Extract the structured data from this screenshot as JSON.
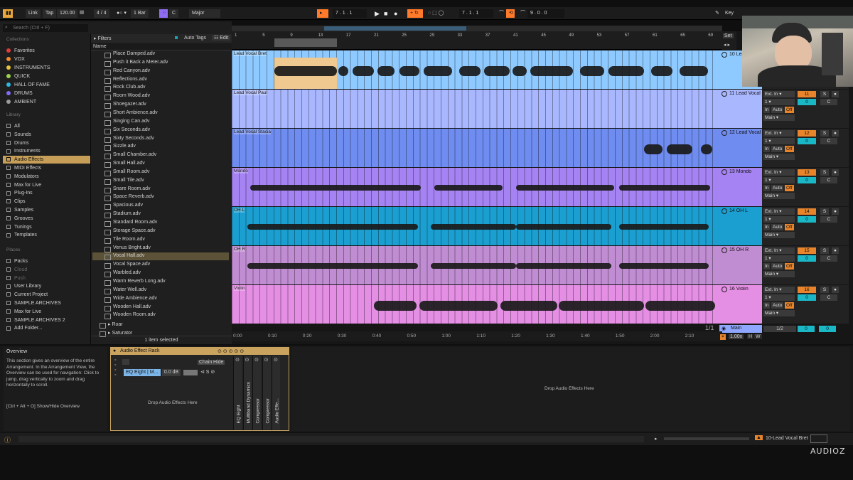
{
  "transport": {
    "link": "Link",
    "tap": "Tap",
    "tempo": "120.00",
    "signature": "4 / 4",
    "quantize": "1 Bar",
    "key": "C",
    "scale": "Major",
    "position": "7 . 1 . 1",
    "loop_start": "7 . 1 . 1",
    "loop_length": "9 . 0 . 0",
    "key_label": "Key"
  },
  "browser": {
    "search_placeholder": "Search (Ctrl + F)",
    "collections_label": "Collections",
    "collections": [
      {
        "label": "Favorites",
        "color": "#e23b3b"
      },
      {
        "label": "VOX",
        "color": "#f08a2c"
      },
      {
        "label": "INSTRUMENTS",
        "color": "#e8c43a"
      },
      {
        "label": "QUICK",
        "color": "#9ad44a"
      },
      {
        "label": "HALL OF FAME",
        "color": "#2fb8e0"
      },
      {
        "label": "DRUMS",
        "color": "#7e6cf2"
      },
      {
        "label": "AMBIENT",
        "color": "#9a9a9a"
      }
    ],
    "library_label": "Library",
    "library": [
      "All",
      "Sounds",
      "Drums",
      "Instruments",
      "Audio Effects",
      "MIDI Effects",
      "Modulators",
      "Max for Live",
      "Plug-Ins",
      "Clips",
      "Samples",
      "Grooves",
      "Tunings",
      "Templates"
    ],
    "places_label": "Places",
    "places": [
      "Packs",
      "Cloud",
      "Push",
      "User Library",
      "Current Project",
      "SAMPLE ARCHIVES",
      "Max for Live",
      "SAMPLE ARCHIVES 2",
      "Add Folder..."
    ],
    "filters_label": "Filters",
    "auto_tags_label": "Auto Tags",
    "edit_label": "Edit",
    "name_header": "Name",
    "files": [
      "Place Damped.adv",
      "Push it Back a Meter.adv",
      "Red Canyon.adv",
      "Reflections.adv",
      "Rock Club.adv",
      "Room Wood.adv",
      "Shoegazer.adv",
      "Short Ambience.adv",
      "Singing Can.adv",
      "Six Seconds.adv",
      "Sixty Seconds.adv",
      "Sizzle.adv",
      "Small Chamber.adv",
      "Small Hall.adv",
      "Small Room.adv",
      "Small Tile.adv",
      "Snare Room.adv",
      "Space Reverb.adv",
      "Spacious.adv",
      "Stadium.adv",
      "Standard Room.adv",
      "Storage Space.adv",
      "Tile Room.adv",
      "Venus Bright.adv",
      "Vocal Hall.adv",
      "Vocal Space.adv",
      "Warbled.adv",
      "Warm Reverb Long.adv",
      "Water Well.adv",
      "Wide Ambience.adv",
      "Wooden Hall.adv",
      "Wooden Room.adv"
    ],
    "folders": [
      "Roar",
      "Saturator"
    ],
    "status": "1 item selected"
  },
  "ruler": {
    "marks": [
      "1",
      "5",
      "9",
      "13",
      "17",
      "21",
      "25",
      "29",
      "33",
      "37",
      "41",
      "45",
      "49",
      "53",
      "57",
      "61",
      "65",
      "69"
    ],
    "set_label": "Set"
  },
  "tracks": [
    {
      "clip": "Lead Vocal Bret",
      "header": "10 Lead Vocal Bret",
      "color": "#8ec9ff",
      "head_color": "#8ec9ff"
    },
    {
      "clip": "Lead Vocal Paul",
      "header": "11 Lead Vocal Paul",
      "color": "#a9b7ff",
      "head_color": "#a9b7ff",
      "input": "Ext. In",
      "ch": "1",
      "num": "11"
    },
    {
      "clip": "Lead Vocal Stacia",
      "header": "12 Lead Vocal Stacia",
      "color": "#6f8cf0",
      "head_color": "#6f8cf0",
      "input": "Ext. In",
      "ch": "1",
      "num": "12"
    },
    {
      "clip": "Mondo",
      "header": "13 Mondo",
      "color": "#a683f3",
      "head_color": "#a683f3",
      "input": "Ext. In",
      "ch": "1",
      "num": "13"
    },
    {
      "clip": "OH L",
      "header": "14 OH L",
      "color": "#1b9fd0",
      "head_color": "#1b9fd0",
      "input": "Ext. In",
      "ch": "1",
      "num": "14"
    },
    {
      "clip": "OH R",
      "header": "15 OH R",
      "color": "#c08cd2",
      "head_color": "#c08cd2",
      "input": "Ext. In",
      "ch": "1",
      "num": "15"
    },
    {
      "clip": "Violin",
      "header": "16 Violin",
      "color": "#e48ee4",
      "head_color": "#e48ee4",
      "input": "Ext. In",
      "ch": "1",
      "num": "16"
    }
  ],
  "mixer_labels": {
    "in": "In",
    "auto": "Auto",
    "off": "Off",
    "main": "Main",
    "s": "S",
    "c": "C",
    "zero": "0"
  },
  "main_track": {
    "label": "Main",
    "fraction": "1/2",
    "page": "1/1",
    "zoom": "1.00x",
    "h": "H",
    "w": "W"
  },
  "timeline": [
    "0:00",
    "0:10",
    "0:20",
    "0:30",
    "0:40",
    "0:50",
    "1:00",
    "1:10",
    "1:20",
    "1:30",
    "1:40",
    "1:50",
    "2:00",
    "2:10"
  ],
  "info": {
    "title": "Overview",
    "body": "This section gives an overview of the entire Arrangement. In the Arrangement View, the Overview can be used for navigation: Click to jump, drag vertically to zoom and drag horizontally to scroll.",
    "shortcut": "[Ctrl + Alt + O] Show/Hide Overview"
  },
  "rack": {
    "title": "Audio Effect Rack",
    "chain_label": "EQ Eight | M...",
    "gain": "0.0 dB",
    "chain_btn": "Chain",
    "hide_btn": "Hide",
    "drop_text": "Drop Audio Effects Here",
    "devices": [
      "EQ Eight",
      "Multiband Dynamics",
      "Compressor",
      "Compressor",
      "Audio Effe..."
    ]
  },
  "drop_main": "Drop Audio Effects Here",
  "status_track": "10-Lead Vocal Bret",
  "watermark": "AUDIOZ"
}
